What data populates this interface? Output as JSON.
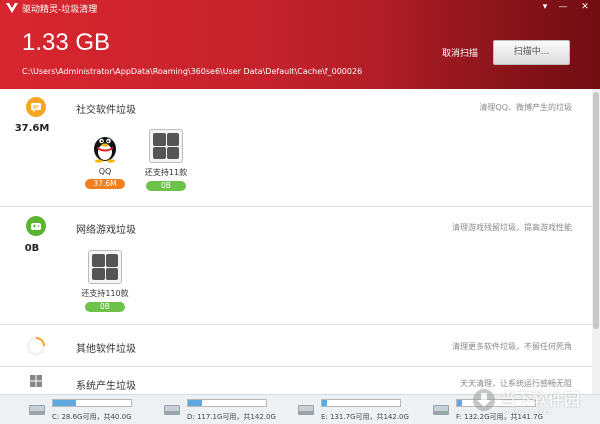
{
  "window": {
    "title": "驱动精灵-垃圾清理",
    "controls": [
      "▾",
      "—",
      "✕"
    ]
  },
  "header": {
    "scanned_size": "1.33 GB",
    "current_path": "C:\\Users\\Administrator\\AppData\\Roaming\\360se6\\User Data\\Default\\Cache\\f_000026",
    "cancel_label": "取消扫描",
    "scan_button_label": "扫描中..."
  },
  "sections": [
    {
      "name": "社交软件垃圾",
      "amount": "37.6M",
      "description": "清理QQ、微博产生的垃圾",
      "icon": "chat-bubble-icon",
      "color": "#f5a623",
      "apps": [
        {
          "label": "QQ",
          "badge": "37.6M",
          "badge_color": "#f07f1c",
          "icon": "qq-penguin-icon"
        },
        {
          "label": "还支持11款",
          "badge": "0B",
          "badge_color": "#6cc24a",
          "icon": "app-grid-icon"
        }
      ]
    },
    {
      "name": "网络游戏垃圾",
      "amount": "0B",
      "description": "清理游戏残留垃圾，提高游戏性能",
      "icon": "gamepad-icon",
      "color": "#5cb531",
      "apps": [
        {
          "label": "还支持110款",
          "badge": "0B",
          "badge_color": "#6cc24a",
          "icon": "game-grid-icon"
        }
      ]
    },
    {
      "name": "其他软件垃圾",
      "amount": "",
      "description": "清理更多软件垃圾，不留任何死角",
      "icon": "loading-spinner-icon",
      "color": "#f5a623"
    },
    {
      "name": "系统产生垃圾",
      "amount": "",
      "description": "天天清理，让系统运行感畅无阻",
      "icon": "windows-logo-icon",
      "color": "#888888"
    }
  ],
  "drives": [
    {
      "text": "C: 28.6G可用，共40.0G",
      "used_fraction": 0.29
    },
    {
      "text": "D: 117.1G可用，共142.0G",
      "used_fraction": 0.18
    },
    {
      "text": "E: 131.7G可用，共142.0G",
      "used_fraction": 0.07
    },
    {
      "text": "F: 132.2G可用，共141.7G",
      "used_fraction": 0.07
    }
  ],
  "watermark": {
    "text": "当下软件园",
    "url": "downxia.com"
  }
}
